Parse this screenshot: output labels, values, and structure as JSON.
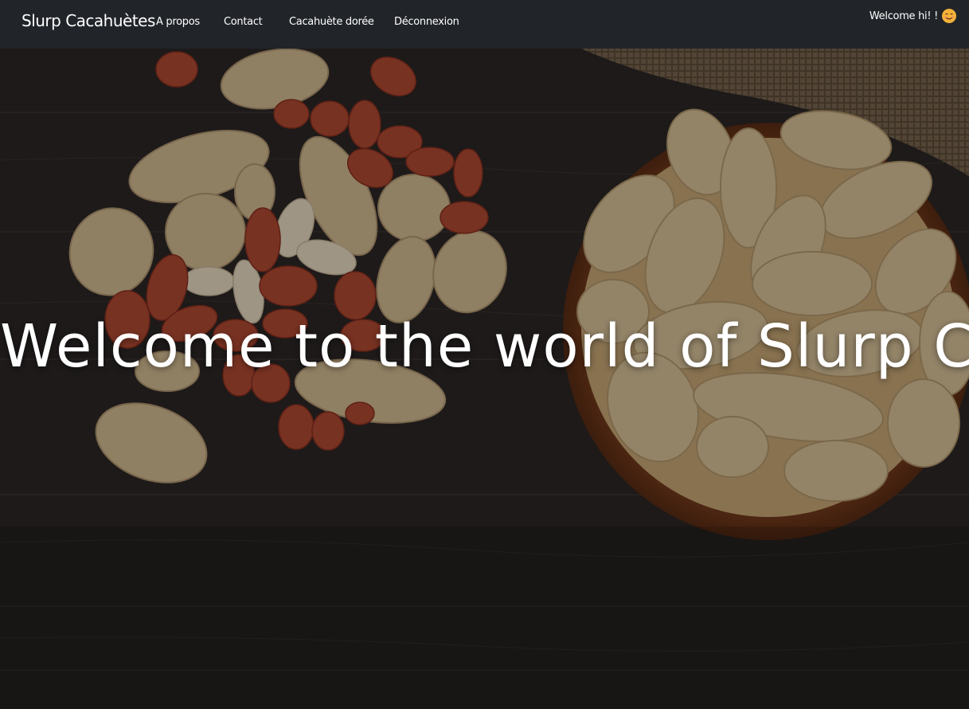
{
  "navbar": {
    "brand": "Slurp Cacahuètes",
    "links": [
      {
        "label": "A propos"
      },
      {
        "label": "Contact"
      },
      {
        "label": "Cacahuète dorée"
      },
      {
        "label": "Déconnexion"
      }
    ],
    "user_greeting": "Welcome hi! !",
    "user_icon": "smiley-emoji-icon"
  },
  "hero": {
    "title": "Welcome to the world of Slurp Cacahète",
    "background": "peanuts-on-wooden-table-photo"
  },
  "colors": {
    "navbar_bg": "#212429",
    "text": "#ffffff",
    "peanut_shell": "#d8c29a",
    "peanut_red": "#b8492d",
    "wood": "#2a2624",
    "bowl": "#8a4a25"
  }
}
